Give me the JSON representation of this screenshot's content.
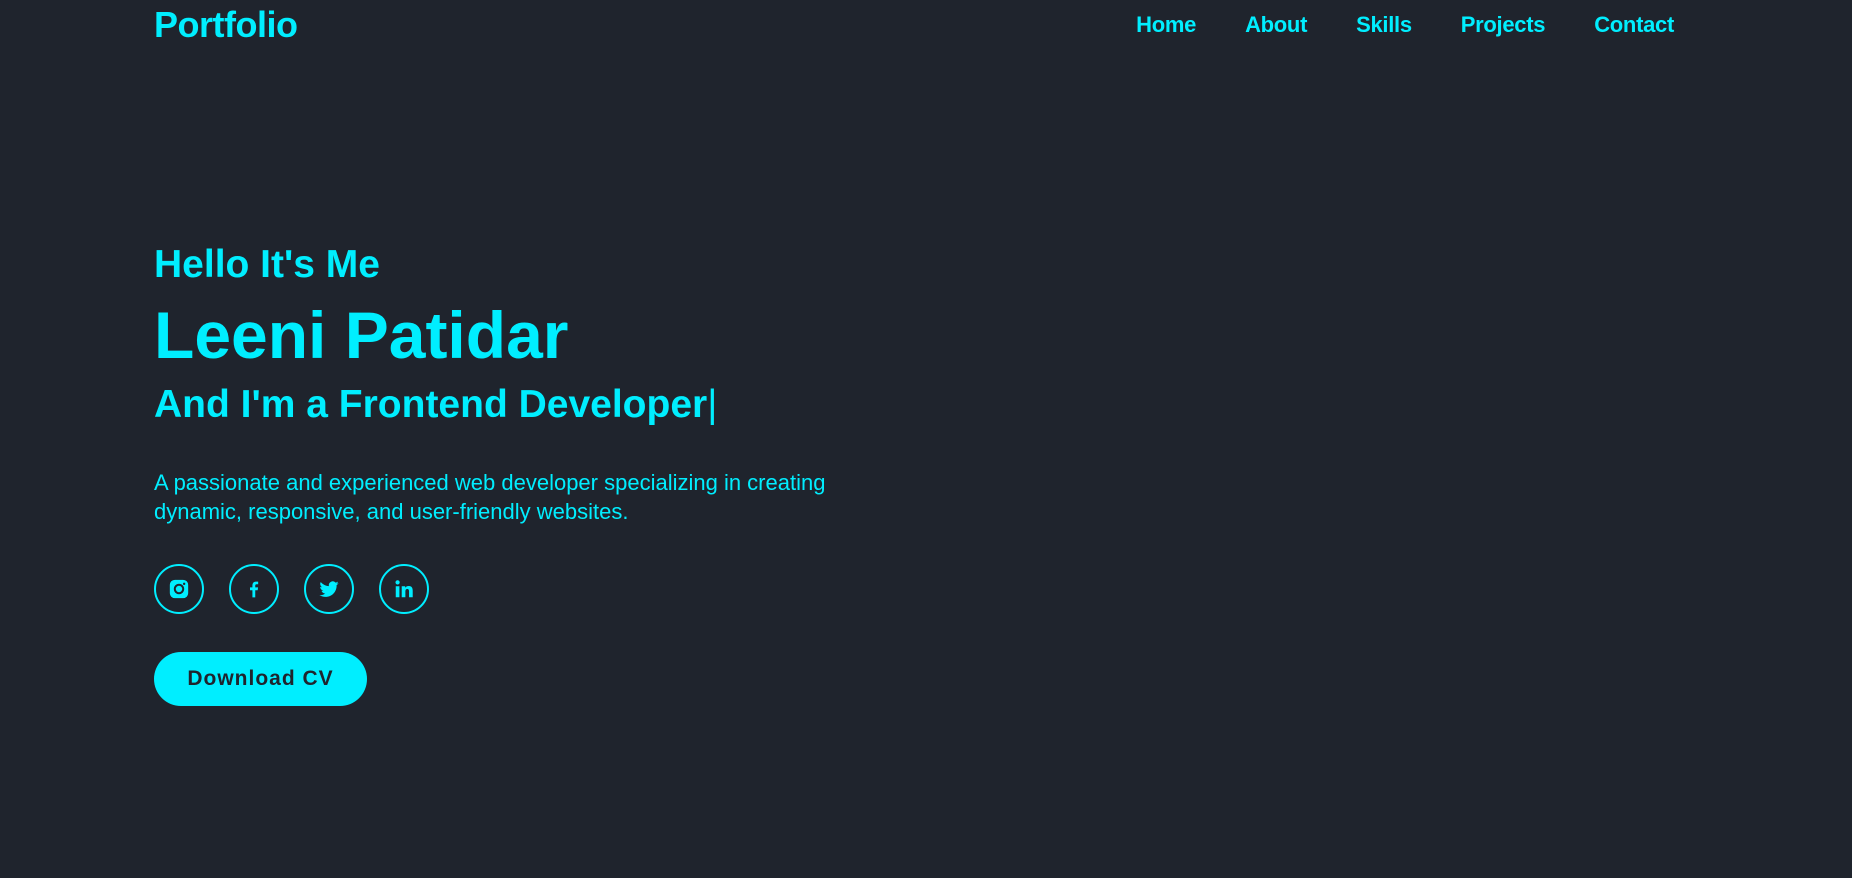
{
  "colors": {
    "background": "#1f242d",
    "accent": "#00eeff",
    "button_text": "#1f242d"
  },
  "header": {
    "logo": "Portfolio",
    "nav": [
      {
        "label": "Home"
      },
      {
        "label": "About"
      },
      {
        "label": "Skills"
      },
      {
        "label": "Projects"
      },
      {
        "label": "Contact"
      }
    ]
  },
  "hero": {
    "greeting": "Hello It's Me",
    "name": "Leeni Patidar",
    "role_prefix": "And I'm a ",
    "role": "Frontend Developer",
    "cursor": "|",
    "description": "A passionate and experienced web developer specializing in creating dynamic, responsive, and user-friendly websites.",
    "socials": [
      {
        "icon": "instagram-icon"
      },
      {
        "icon": "facebook-icon"
      },
      {
        "icon": "twitter-icon"
      },
      {
        "icon": "linkedin-icon"
      }
    ],
    "cta_label": "Download CV"
  }
}
